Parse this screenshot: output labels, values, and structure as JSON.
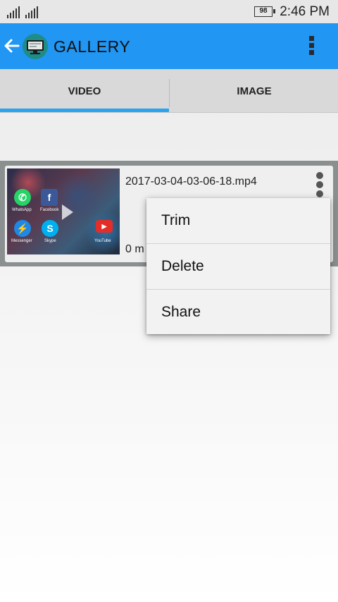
{
  "status_bar": {
    "battery": "98",
    "time": "2:46 PM"
  },
  "app_bar": {
    "title": "GALLERY",
    "icons": [
      "back-arrow-icon",
      "app-logo-icon",
      "overflow-menu-icon"
    ]
  },
  "tabs": [
    {
      "label": "VIDEO",
      "selected": true
    },
    {
      "label": "IMAGE",
      "selected": false
    }
  ],
  "video_item": {
    "filename": "2017-03-04-03-06-18.mp4",
    "duration": "0 m",
    "thumbnail_apps": [
      "WhatsApp",
      "Facebook",
      "Messenger",
      "Skype",
      "YouTube"
    ]
  },
  "context_menu": {
    "items": [
      "Trim",
      "Delete",
      "Share"
    ]
  },
  "colors": {
    "app_bar": "#2196f3",
    "tab_indicator": "#29a3f0",
    "tab_bar": "#d9d9d9"
  }
}
